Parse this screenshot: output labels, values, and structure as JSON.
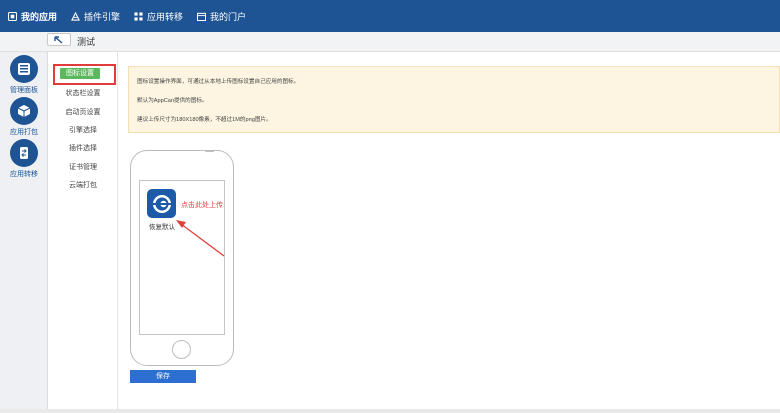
{
  "topnav": {
    "items": [
      {
        "label": "我的应用",
        "icon": "app-square-icon"
      },
      {
        "label": "插件引擎",
        "icon": "plugin-icon"
      },
      {
        "label": "应用转移",
        "icon": "grid-icon"
      },
      {
        "label": "我的门户",
        "icon": "portal-icon"
      }
    ]
  },
  "subbar": {
    "back_icon": "back-arrow-icon",
    "title": "测试"
  },
  "rail": {
    "items": [
      {
        "label": "管理面板",
        "icon": "dashboard-icon"
      },
      {
        "label": "应用打包",
        "icon": "package-icon"
      },
      {
        "label": "应用转移",
        "icon": "transfer-icon"
      }
    ]
  },
  "submenu": {
    "active": "图标设置",
    "items": [
      "状态栏设置",
      "启动页设置",
      "引擎选择",
      "插件选择",
      "证书管理",
      "云端打包"
    ]
  },
  "notice": {
    "line1": "图标设置操作界面，可通过从本地上传图标设置自己应用的图标。",
    "line2": "默认为AppCan提供的图标。",
    "line3": "建议上传尺寸为180X180像素，不超过1M的png图片。"
  },
  "phone": {
    "restore_label": "恢复默认",
    "upload_hint": "点击此处上传",
    "app_icon": "appcan-logo-icon"
  },
  "actions": {
    "save_label": "保存"
  },
  "colors": {
    "brand": "#1e5394",
    "save": "#2c6fd0",
    "active_tab": "#5cb85c",
    "highlight": "#e23b3b",
    "notice_bg": "#fdf5e1"
  }
}
